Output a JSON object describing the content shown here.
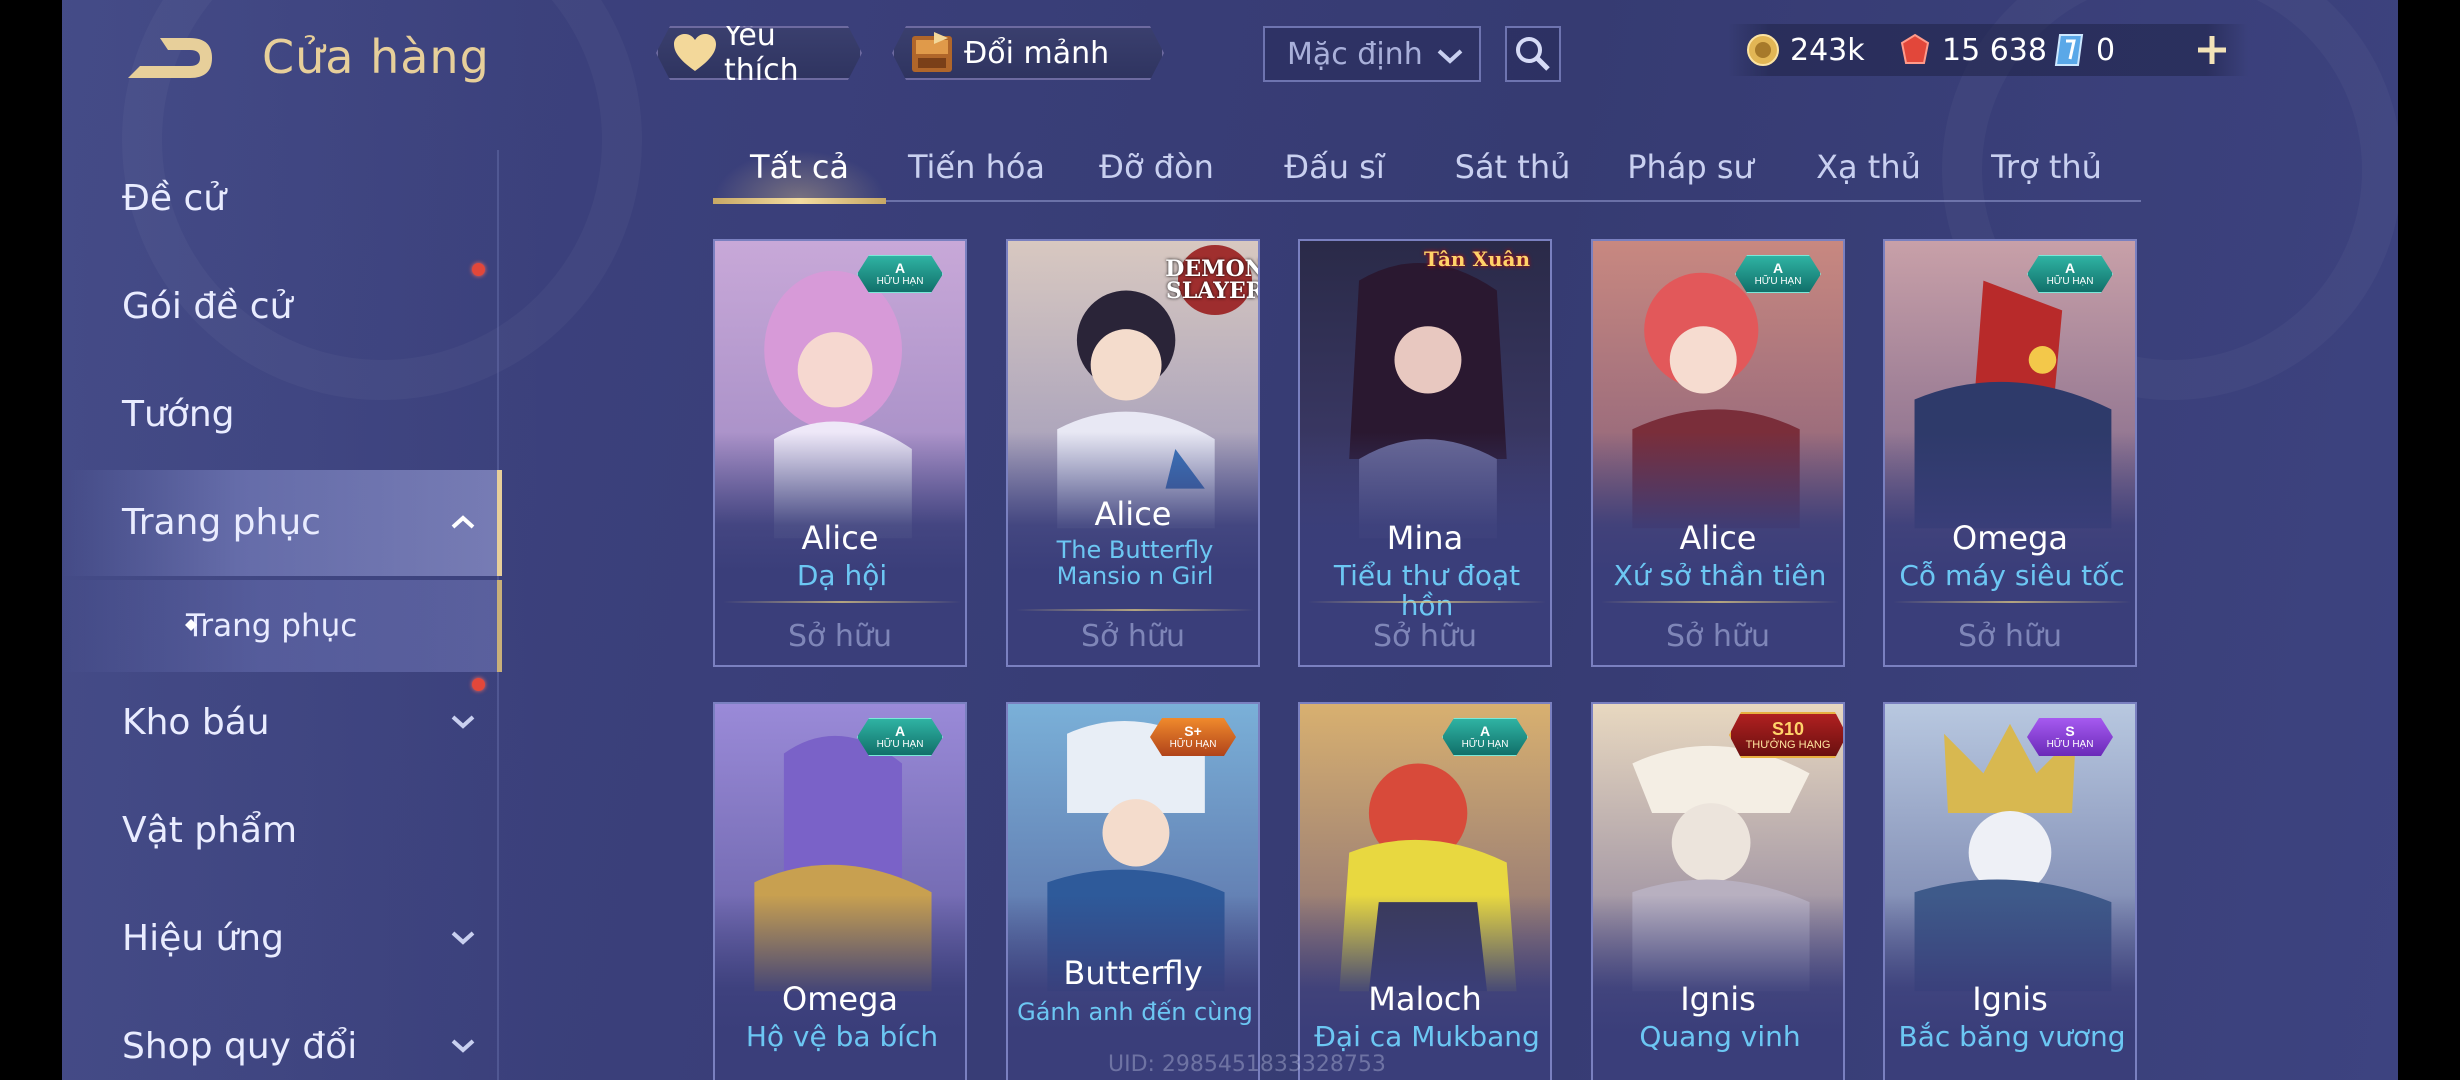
{
  "header": {
    "title": "Cửa hàng",
    "favorite_label": "Yêu thích",
    "fragment_label": "Đổi mảnh",
    "sort_selected": "Mặc định"
  },
  "currency": {
    "gold": "243k",
    "gems": "15 638",
    "tickets": "0"
  },
  "sidebar": {
    "items": [
      {
        "label": "Đề cử"
      },
      {
        "label": "Gói đề cử"
      },
      {
        "label": "Tướng"
      },
      {
        "label": "Trang phục"
      },
      {
        "label": "Trang phục"
      },
      {
        "label": "Kho báu"
      },
      {
        "label": "Vật phẩm"
      },
      {
        "label": "Hiệu ứng"
      },
      {
        "label": "Shop quy đổi"
      }
    ]
  },
  "tabs": [
    {
      "label": "Tất cả"
    },
    {
      "label": "Tiến hóa"
    },
    {
      "label": "Đỡ đòn"
    },
    {
      "label": "Đấu sĩ"
    },
    {
      "label": "Sát thủ"
    },
    {
      "label": "Pháp sư"
    },
    {
      "label": "Xạ thủ"
    },
    {
      "label": "Trợ thủ"
    }
  ],
  "cards": [
    {
      "hero": "Alice",
      "skin": "Dạ hội",
      "status": "Sở hữu",
      "badge_grade": "A",
      "badge_label": "HỮU HẠN"
    },
    {
      "hero": "Alice",
      "skin": "The Butterfly Mansio n Girl",
      "status": "Sở hữu",
      "corner_logo": "DEMON SLAYER"
    },
    {
      "hero": "Mina",
      "skin": "Tiểu thư đoạt hồn",
      "status": "Sở hữu",
      "corner_logo": "Tân Xuân"
    },
    {
      "hero": "Alice",
      "skin": "Xứ sở thần tiên",
      "status": "Sở hữu",
      "badge_grade": "A",
      "badge_label": "HỮU HẠN"
    },
    {
      "hero": "Omega",
      "skin": "Cỗ máy siêu tốc",
      "status": "Sở hữu",
      "badge_grade": "A",
      "badge_label": "HỮU HẠN"
    },
    {
      "hero": "Omega",
      "skin": "Hộ vệ ba bích",
      "badge_grade": "A",
      "badge_label": "HỮU HẠN"
    },
    {
      "hero": "Butterfly",
      "skin": "Gánh anh đến cùng",
      "badge_grade": "S+",
      "badge_label": "HỮU HẠN"
    },
    {
      "hero": "Maloch",
      "skin": "Đại ca Mukbang",
      "badge_grade": "A",
      "badge_label": "HỮU HẠN"
    },
    {
      "hero": "Ignis",
      "skin": "Quang vinh",
      "badge_grade": "S10",
      "badge_label": "THƯỞNG HẠNG"
    },
    {
      "hero": "Ignis",
      "skin": "Bắc băng vương",
      "badge_grade": "S",
      "badge_label": "HỮU HẠN"
    }
  ],
  "footer": {
    "uid": "UID: 2985451833328753"
  },
  "colors": {
    "accent_gold": "#e7cf9a",
    "skin_name_blue": "#6cc7f3",
    "background": "#3a3f7a",
    "notification_red": "#e2473a"
  }
}
